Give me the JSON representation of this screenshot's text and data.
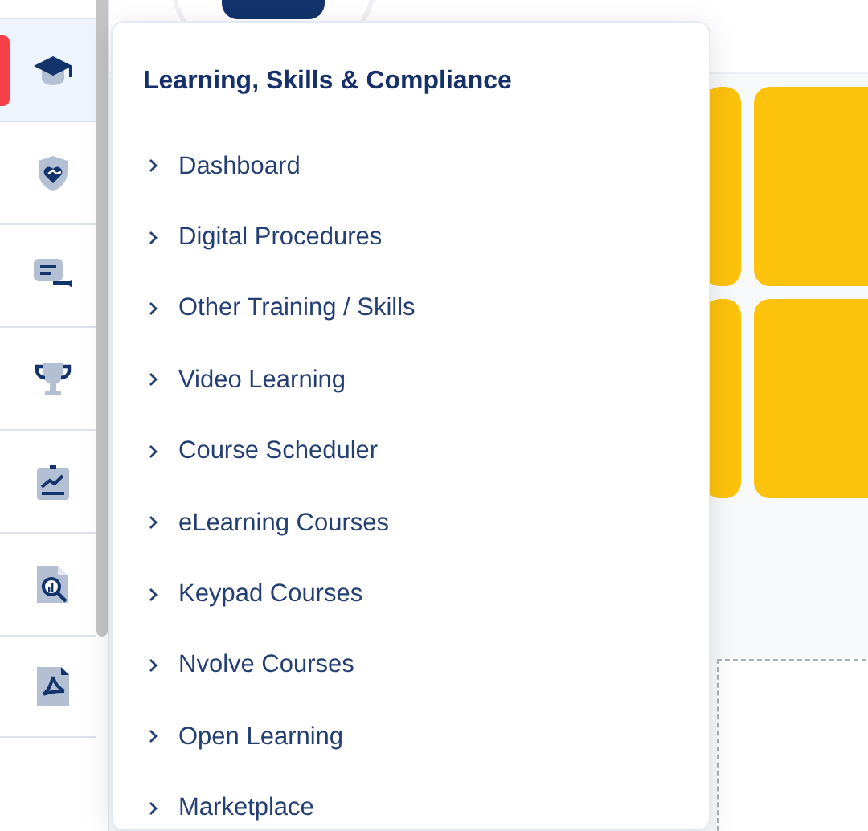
{
  "sidebar": {
    "items": [
      {
        "selected": true
      },
      {
        "selected": false
      },
      {
        "selected": false
      },
      {
        "selected": false
      },
      {
        "selected": false
      },
      {
        "selected": false
      },
      {
        "selected": false
      }
    ]
  },
  "menu": {
    "title": "Learning, Skills & Compliance",
    "items": [
      {
        "label": "Dashboard"
      },
      {
        "label": "Digital Procedures"
      },
      {
        "label": "Other Training / Skills"
      },
      {
        "label": "Video Learning"
      },
      {
        "label": "Course Scheduler"
      },
      {
        "label": "eLearning Courses"
      },
      {
        "label": "Keypad Courses"
      },
      {
        "label": "Nvolve Courses"
      },
      {
        "label": "Open Learning"
      },
      {
        "label": "Marketplace"
      }
    ]
  }
}
